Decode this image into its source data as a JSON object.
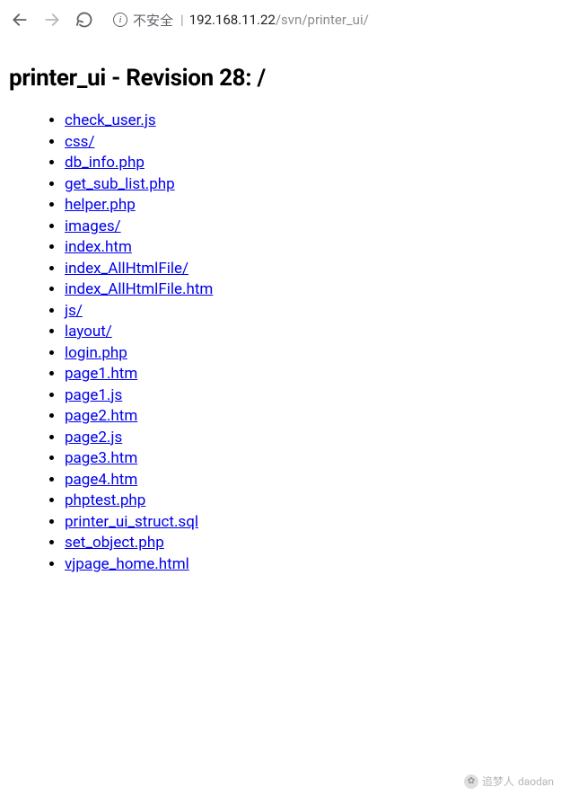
{
  "browser": {
    "insecure_label": "不安全",
    "url_host": "192.168.11.22",
    "url_path": "/svn/printer_ui/"
  },
  "page": {
    "heading": "printer_ui - Revision 28: /"
  },
  "listing": [
    "check_user.js",
    "css/",
    "db_info.php",
    "get_sub_list.php",
    "helper.php",
    "images/",
    "index.htm",
    "index_AllHtmlFile/",
    "index_AllHtmlFile.htm",
    "js/",
    "layout/",
    "login.php",
    "page1.htm",
    "page1.js",
    "page2.htm",
    "page2.js",
    "page3.htm",
    "page4.htm",
    "phptest.php",
    "printer_ui_struct.sql",
    "set_object.php",
    "vjpage_home.html"
  ],
  "watermark": {
    "text1": "追梦人",
    "text2": "daodan"
  }
}
